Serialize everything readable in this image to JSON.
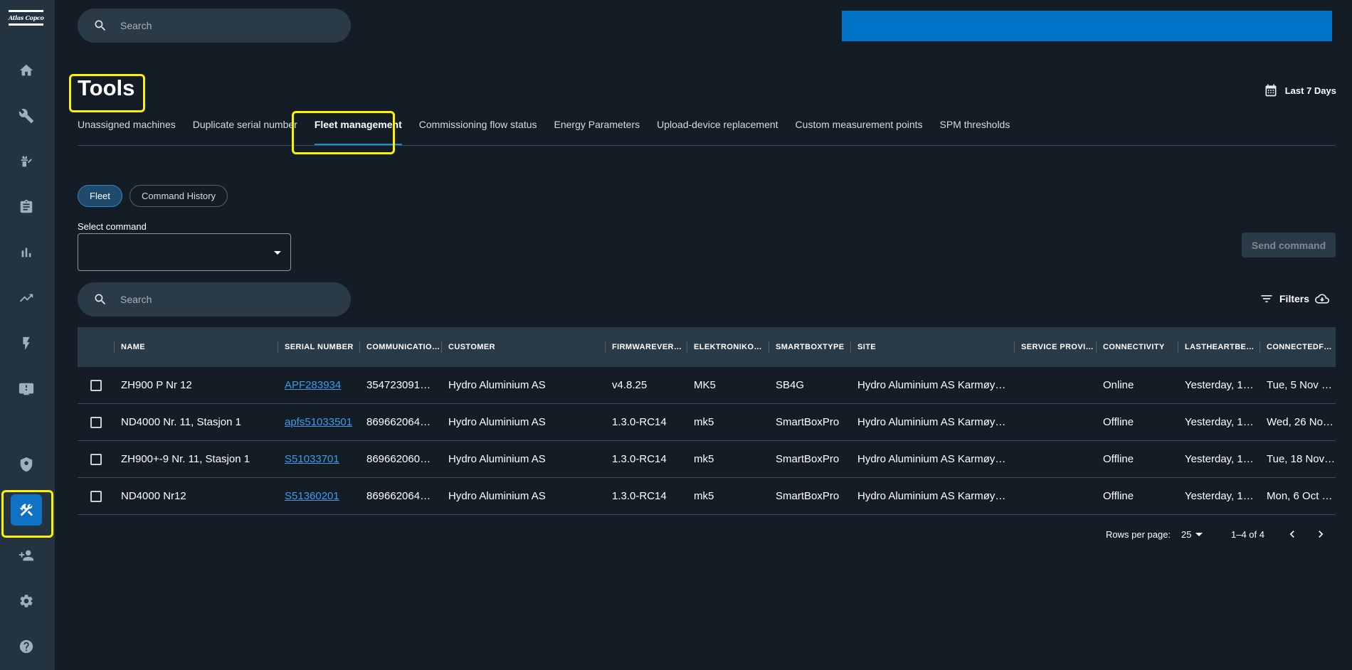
{
  "brand": {
    "logo_text": "Atlas Copco"
  },
  "sidebar": {
    "items": [
      {
        "name": "home-icon"
      },
      {
        "name": "wrench-icon"
      },
      {
        "name": "service-engineer-icon"
      },
      {
        "name": "clipboard-icon"
      },
      {
        "name": "bar-chart-icon"
      },
      {
        "name": "trending-icon"
      },
      {
        "name": "energy-icon"
      },
      {
        "name": "monitor-alert-icon"
      },
      {
        "name": "security-settings-icon"
      },
      {
        "name": "tools-icon",
        "active": true
      },
      {
        "name": "add-user-icon"
      },
      {
        "name": "gear-icon"
      },
      {
        "name": "help-icon"
      }
    ]
  },
  "top_search": {
    "placeholder": "Search"
  },
  "page": {
    "title": "Tools",
    "date_range": "Last 7 Days"
  },
  "tabs": [
    {
      "label": "Unassigned machines"
    },
    {
      "label": "Duplicate serial number"
    },
    {
      "label": "Fleet management",
      "active": true
    },
    {
      "label": "Commissioning flow status"
    },
    {
      "label": "Energy Parameters"
    },
    {
      "label": "Upload-device replacement"
    },
    {
      "label": "Custom measurement points"
    },
    {
      "label": "SPM thresholds"
    }
  ],
  "chips": {
    "fleet": "Fleet",
    "history": "Command History"
  },
  "command": {
    "label": "Select command",
    "value": "",
    "send_label": "Send command"
  },
  "table_search": {
    "placeholder": "Search"
  },
  "filters_label": "Filters",
  "table": {
    "headers": [
      "NAME",
      "SERIAL NUMBER",
      "COMMUNICATIO…",
      "CUSTOMER",
      "FIRMWAREVERSI…",
      "ELEKTRONIKON…",
      "SMARTBOXTYPE",
      "SITE",
      "SERVICE PROVID…",
      "CONNECTIVITY",
      "LASTHEARTBEA…",
      "CONNECTEDFROM"
    ],
    "rows": [
      [
        "ZH900 P Nr 12",
        "APF283934",
        "354723091…",
        "Hydro Aluminium AS",
        "v4.8.25",
        "MK5",
        "SB4G",
        "Hydro Aluminium AS Karmøy…",
        "",
        "Online",
        "Yesterday, 1…",
        "Tue, 5 Nov …"
      ],
      [
        "ND4000 Nr. 11, Stasjon 1",
        "apfs51033501",
        "869662064…",
        "Hydro Aluminium AS",
        "1.3.0-RC14",
        "mk5",
        "SmartBoxPro",
        "Hydro Aluminium AS Karmøy…",
        "",
        "Offline",
        "Yesterday, 1…",
        "Wed, 26 No…"
      ],
      [
        "ZH900+-9 Nr. 11, Stasjon 1",
        "S51033701",
        "869662060…",
        "Hydro Aluminium AS",
        "1.3.0-RC14",
        "mk5",
        "SmartBoxPro",
        "Hydro Aluminium AS Karmøy…",
        "",
        "Offline",
        "Yesterday, 1…",
        "Tue, 18 Nov…"
      ],
      [
        "ND4000 Nr12",
        "S51360201",
        "869662064…",
        "Hydro Aluminium AS",
        "1.3.0-RC14",
        "mk5",
        "SmartBoxPro",
        "Hydro Aluminium AS Karmøy…",
        "",
        "Offline",
        "Yesterday, 1…",
        "Mon, 6 Oct …"
      ]
    ]
  },
  "pagination": {
    "rows_per_page_label": "Rows per page:",
    "rows_per_page": "25",
    "range": "1–4 of 4"
  }
}
